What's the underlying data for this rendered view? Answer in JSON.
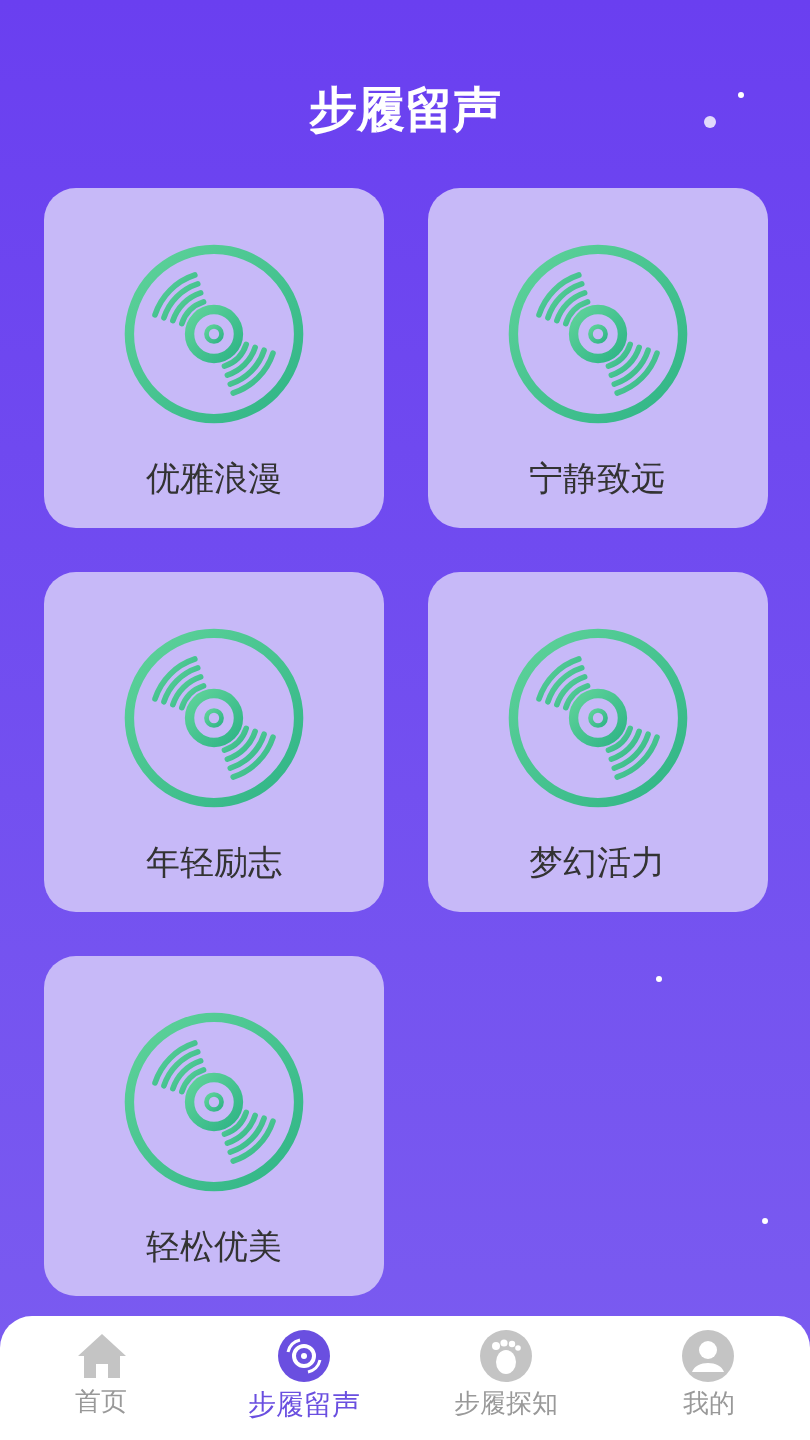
{
  "header": {
    "title": "步履留声"
  },
  "cards": [
    {
      "label": "优雅浪漫"
    },
    {
      "label": "宁静致远"
    },
    {
      "label": "年轻励志"
    },
    {
      "label": "梦幻活力"
    },
    {
      "label": "轻松优美"
    }
  ],
  "tabbar": [
    {
      "kind": "home",
      "label": "首页",
      "selected": false
    },
    {
      "kind": "disc",
      "label": "步履留声",
      "selected": true
    },
    {
      "kind": "foot",
      "label": "步履探知",
      "selected": false
    },
    {
      "kind": "user",
      "label": "我的",
      "selected": false
    }
  ]
}
